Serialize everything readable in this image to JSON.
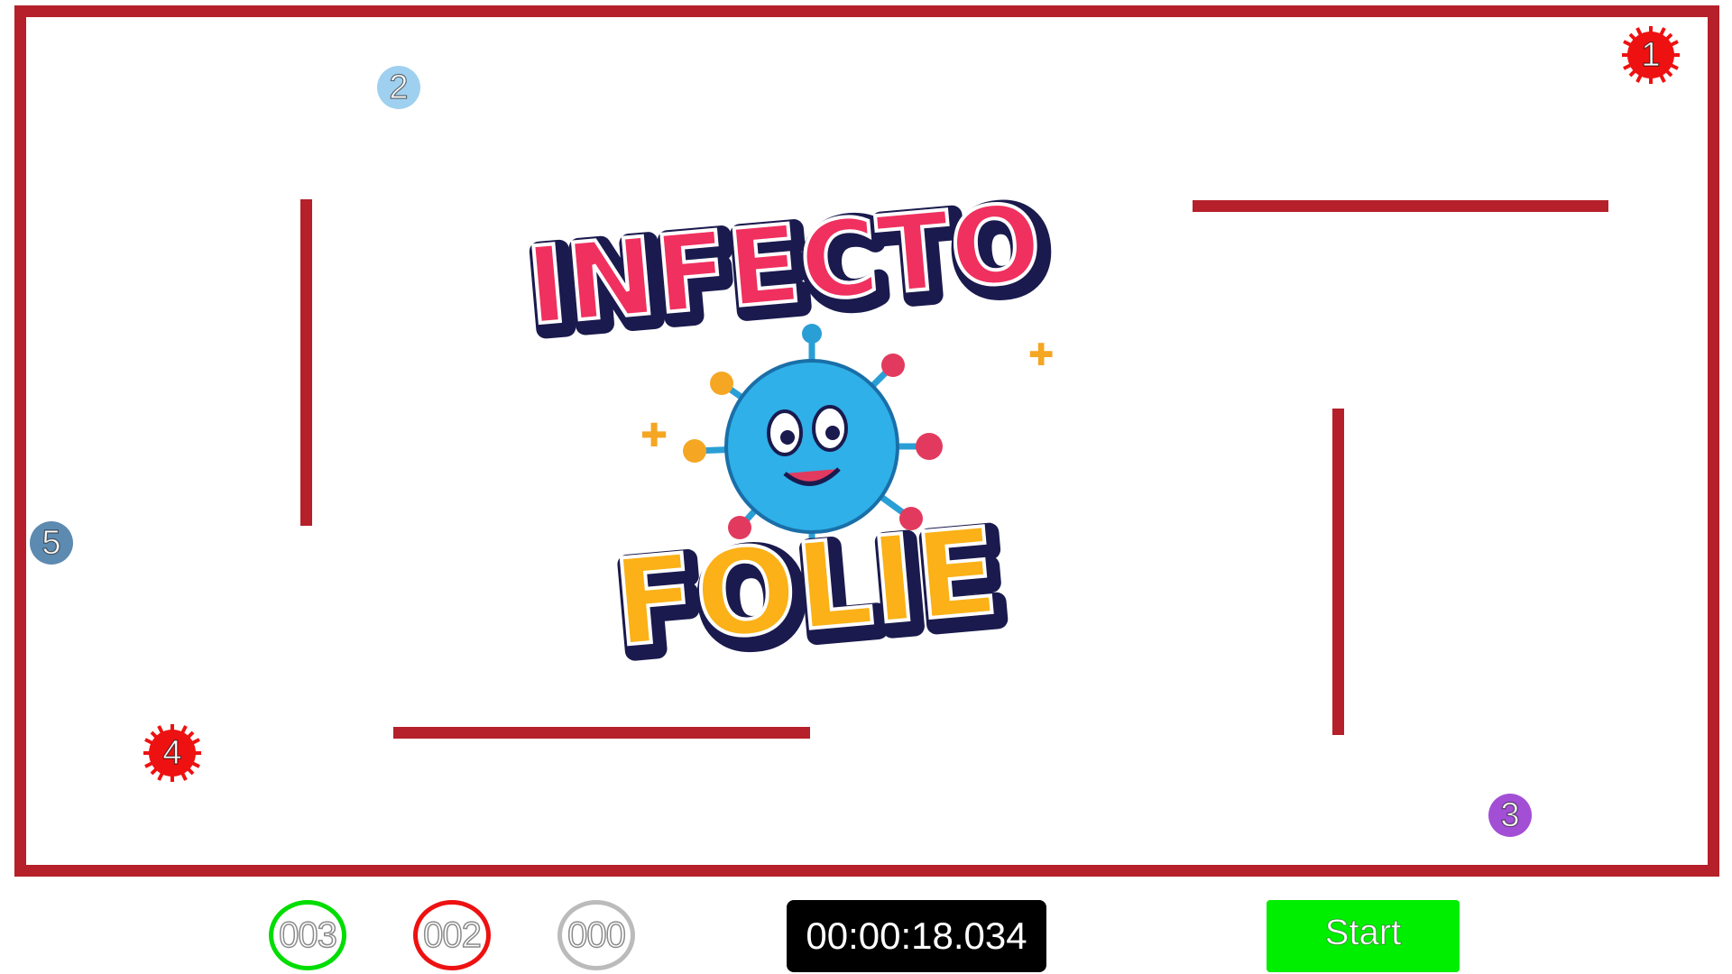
{
  "game": {
    "title_line1": "INFECTO",
    "title_line2": "FOLIE"
  },
  "entities": [
    {
      "id": "1",
      "kind": "virus",
      "color": "#ee1111"
    },
    {
      "id": "2",
      "kind": "ball",
      "color": "#9fd0ef"
    },
    {
      "id": "3",
      "kind": "ball",
      "color": "#a24fd6"
    },
    {
      "id": "4",
      "kind": "virus",
      "color": "#ee1111"
    },
    {
      "id": "5",
      "kind": "ball",
      "color": "#5d8ab0"
    }
  ],
  "scores": {
    "healthy": {
      "label": "003",
      "color": "#00dd00"
    },
    "infected": {
      "label": "002",
      "color": "#ee1111"
    },
    "removed": {
      "label": "000",
      "color": "#bbbbbb"
    }
  },
  "timer": "00:00:18.034",
  "start_label": "Start",
  "colors": {
    "wall": "#b5202a",
    "start_button": "#00ee00",
    "timer_bg": "#000000"
  }
}
